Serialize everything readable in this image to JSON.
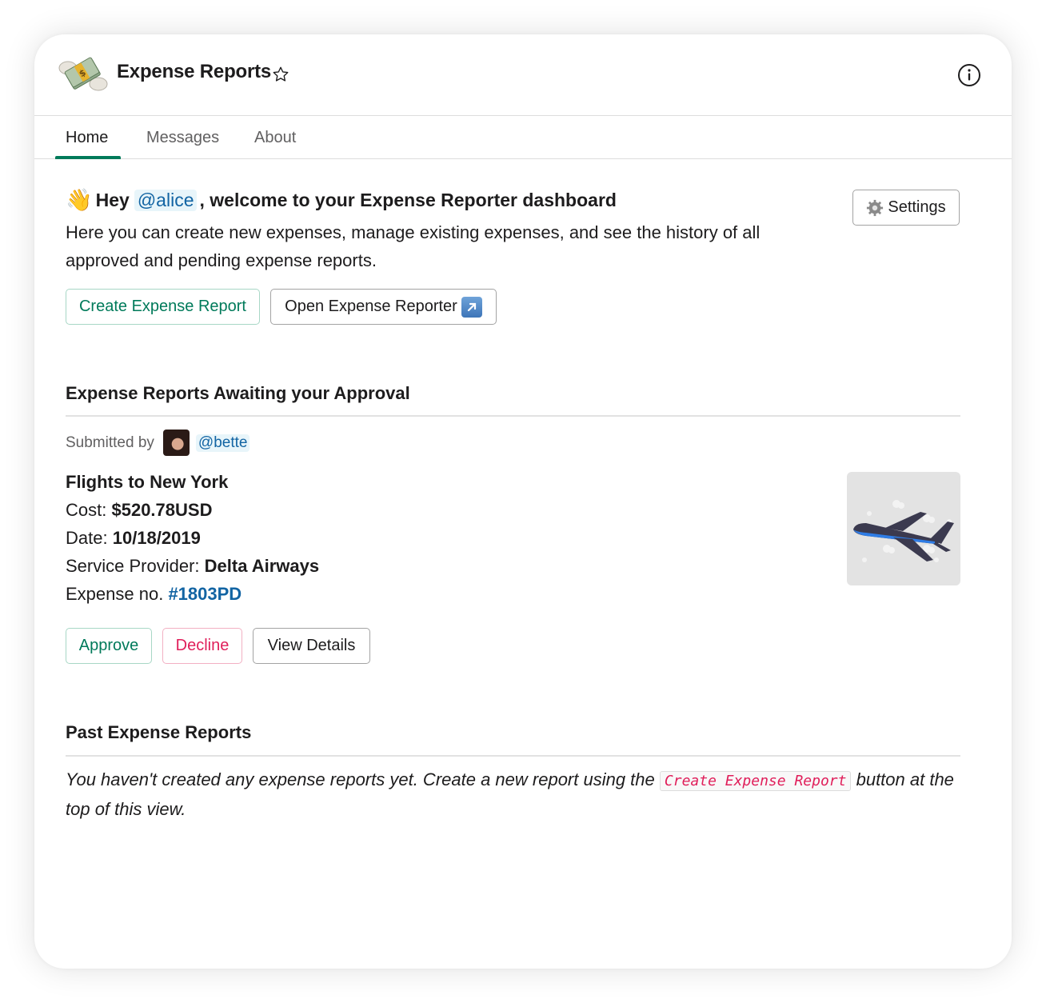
{
  "app": {
    "title": "Expense Reports",
    "icon": "money-with-wings-icon"
  },
  "tabs": [
    {
      "label": "Home",
      "active": true
    },
    {
      "label": "Messages",
      "active": false
    },
    {
      "label": "About",
      "active": false
    }
  ],
  "welcome": {
    "wave_emoji": "👋",
    "greeting_prefix": "Hey",
    "user_mention": "@alice",
    "greeting_suffix": ", welcome to your Expense Reporter dashboard",
    "intro": "Here you can create new expenses, manage existing expenses, and see the history of all approved and pending expense reports."
  },
  "buttons": {
    "settings": "Settings",
    "create_report": "Create Expense Report",
    "open_reporter": "Open Expense Reporter"
  },
  "awaiting": {
    "title": "Expense Reports Awaiting your Approval",
    "submitted_by_label": "Submitted by",
    "submitter": "@bette",
    "report": {
      "name": "Flights to New York",
      "cost_label": "Cost:",
      "cost_value": "$520.78USD",
      "date_label": "Date:",
      "date_value": "10/18/2019",
      "provider_label": "Service Provider:",
      "provider_value": "Delta Airways",
      "expense_no_label": "Expense no.",
      "expense_no_value": "#1803PD"
    },
    "actions": {
      "approve": "Approve",
      "decline": "Decline",
      "view_details": "View Details"
    }
  },
  "past": {
    "title": "Past Expense Reports",
    "empty_prefix": "You haven't created any expense reports yet. Create a new report using the",
    "empty_code": "Create Expense Report",
    "empty_suffix": "button at the top of this view."
  },
  "colors": {
    "accent_green": "#007a5a",
    "danger_red": "#e01e5a",
    "link_blue": "#1264a3"
  }
}
